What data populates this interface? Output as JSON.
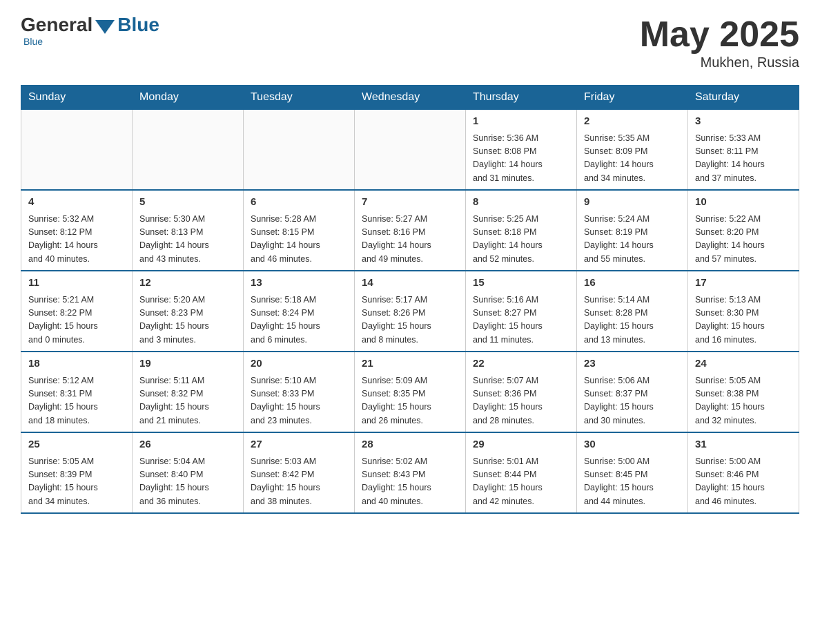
{
  "header": {
    "logo_general": "General",
    "logo_blue": "Blue",
    "month_year": "May 2025",
    "location": "Mukhen, Russia"
  },
  "days_of_week": [
    "Sunday",
    "Monday",
    "Tuesday",
    "Wednesday",
    "Thursday",
    "Friday",
    "Saturday"
  ],
  "weeks": [
    [
      {
        "day": "",
        "info": ""
      },
      {
        "day": "",
        "info": ""
      },
      {
        "day": "",
        "info": ""
      },
      {
        "day": "",
        "info": ""
      },
      {
        "day": "1",
        "info": "Sunrise: 5:36 AM\nSunset: 8:08 PM\nDaylight: 14 hours\nand 31 minutes."
      },
      {
        "day": "2",
        "info": "Sunrise: 5:35 AM\nSunset: 8:09 PM\nDaylight: 14 hours\nand 34 minutes."
      },
      {
        "day": "3",
        "info": "Sunrise: 5:33 AM\nSunset: 8:11 PM\nDaylight: 14 hours\nand 37 minutes."
      }
    ],
    [
      {
        "day": "4",
        "info": "Sunrise: 5:32 AM\nSunset: 8:12 PM\nDaylight: 14 hours\nand 40 minutes."
      },
      {
        "day": "5",
        "info": "Sunrise: 5:30 AM\nSunset: 8:13 PM\nDaylight: 14 hours\nand 43 minutes."
      },
      {
        "day": "6",
        "info": "Sunrise: 5:28 AM\nSunset: 8:15 PM\nDaylight: 14 hours\nand 46 minutes."
      },
      {
        "day": "7",
        "info": "Sunrise: 5:27 AM\nSunset: 8:16 PM\nDaylight: 14 hours\nand 49 minutes."
      },
      {
        "day": "8",
        "info": "Sunrise: 5:25 AM\nSunset: 8:18 PM\nDaylight: 14 hours\nand 52 minutes."
      },
      {
        "day": "9",
        "info": "Sunrise: 5:24 AM\nSunset: 8:19 PM\nDaylight: 14 hours\nand 55 minutes."
      },
      {
        "day": "10",
        "info": "Sunrise: 5:22 AM\nSunset: 8:20 PM\nDaylight: 14 hours\nand 57 minutes."
      }
    ],
    [
      {
        "day": "11",
        "info": "Sunrise: 5:21 AM\nSunset: 8:22 PM\nDaylight: 15 hours\nand 0 minutes."
      },
      {
        "day": "12",
        "info": "Sunrise: 5:20 AM\nSunset: 8:23 PM\nDaylight: 15 hours\nand 3 minutes."
      },
      {
        "day": "13",
        "info": "Sunrise: 5:18 AM\nSunset: 8:24 PM\nDaylight: 15 hours\nand 6 minutes."
      },
      {
        "day": "14",
        "info": "Sunrise: 5:17 AM\nSunset: 8:26 PM\nDaylight: 15 hours\nand 8 minutes."
      },
      {
        "day": "15",
        "info": "Sunrise: 5:16 AM\nSunset: 8:27 PM\nDaylight: 15 hours\nand 11 minutes."
      },
      {
        "day": "16",
        "info": "Sunrise: 5:14 AM\nSunset: 8:28 PM\nDaylight: 15 hours\nand 13 minutes."
      },
      {
        "day": "17",
        "info": "Sunrise: 5:13 AM\nSunset: 8:30 PM\nDaylight: 15 hours\nand 16 minutes."
      }
    ],
    [
      {
        "day": "18",
        "info": "Sunrise: 5:12 AM\nSunset: 8:31 PM\nDaylight: 15 hours\nand 18 minutes."
      },
      {
        "day": "19",
        "info": "Sunrise: 5:11 AM\nSunset: 8:32 PM\nDaylight: 15 hours\nand 21 minutes."
      },
      {
        "day": "20",
        "info": "Sunrise: 5:10 AM\nSunset: 8:33 PM\nDaylight: 15 hours\nand 23 minutes."
      },
      {
        "day": "21",
        "info": "Sunrise: 5:09 AM\nSunset: 8:35 PM\nDaylight: 15 hours\nand 26 minutes."
      },
      {
        "day": "22",
        "info": "Sunrise: 5:07 AM\nSunset: 8:36 PM\nDaylight: 15 hours\nand 28 minutes."
      },
      {
        "day": "23",
        "info": "Sunrise: 5:06 AM\nSunset: 8:37 PM\nDaylight: 15 hours\nand 30 minutes."
      },
      {
        "day": "24",
        "info": "Sunrise: 5:05 AM\nSunset: 8:38 PM\nDaylight: 15 hours\nand 32 minutes."
      }
    ],
    [
      {
        "day": "25",
        "info": "Sunrise: 5:05 AM\nSunset: 8:39 PM\nDaylight: 15 hours\nand 34 minutes."
      },
      {
        "day": "26",
        "info": "Sunrise: 5:04 AM\nSunset: 8:40 PM\nDaylight: 15 hours\nand 36 minutes."
      },
      {
        "day": "27",
        "info": "Sunrise: 5:03 AM\nSunset: 8:42 PM\nDaylight: 15 hours\nand 38 minutes."
      },
      {
        "day": "28",
        "info": "Sunrise: 5:02 AM\nSunset: 8:43 PM\nDaylight: 15 hours\nand 40 minutes."
      },
      {
        "day": "29",
        "info": "Sunrise: 5:01 AM\nSunset: 8:44 PM\nDaylight: 15 hours\nand 42 minutes."
      },
      {
        "day": "30",
        "info": "Sunrise: 5:00 AM\nSunset: 8:45 PM\nDaylight: 15 hours\nand 44 minutes."
      },
      {
        "day": "31",
        "info": "Sunrise: 5:00 AM\nSunset: 8:46 PM\nDaylight: 15 hours\nand 46 minutes."
      }
    ]
  ]
}
